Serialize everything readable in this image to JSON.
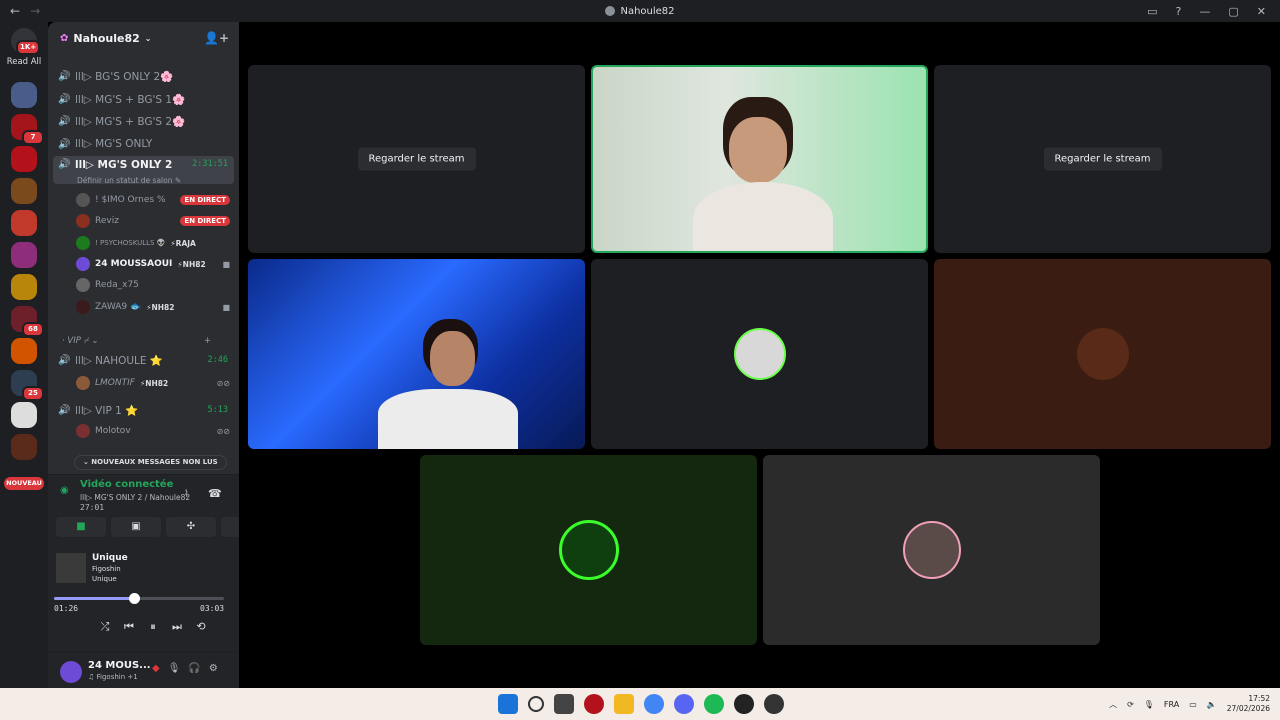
{
  "window": {
    "title": "Nahoule82",
    "back_icon": "←",
    "fwd_icon": "→"
  },
  "rail": {
    "read_all": "Read All",
    "top_badge": "1K+",
    "nouveau": "NOUVEAU",
    "servers": [
      {
        "color": "#4a5d8a",
        "badge": ""
      },
      {
        "color": "#a3141b",
        "badge": "7"
      },
      {
        "color": "#b3121b",
        "badge": ""
      },
      {
        "color": "#7a4a1c",
        "badge": ""
      },
      {
        "color": "#c0392b",
        "badge": ""
      },
      {
        "color": "#8e2d7a",
        "badge": ""
      },
      {
        "color": "#b8860b",
        "badge": ""
      },
      {
        "color": "#6d1f2a",
        "badge": "68"
      },
      {
        "color": "#d35400",
        "badge": ""
      },
      {
        "color": "#2c3e50",
        "badge": "25"
      },
      {
        "color": "#dddddd",
        "badge": ""
      },
      {
        "color": "#5a2a1a",
        "badge": ""
      }
    ]
  },
  "server": {
    "name": "Nahoule82"
  },
  "channels": [
    {
      "name": "lll▷ BG'S ONLY 2🌸"
    },
    {
      "name": "lll▷ MG'S + BG'S 1🌸"
    },
    {
      "name": "lll▷ MG'S + BG'S 2🌸"
    },
    {
      "name": "lll▷ MG'S ONLY"
    }
  ],
  "active_channel": {
    "name": "lll▷ MG'S ONLY 2",
    "time": "2:31:51",
    "status_hint": "Définir un statut de salon ✎"
  },
  "members": [
    {
      "name": "! $IMO Ornes %",
      "tag": "",
      "live": "EN DIRECT",
      "color": "#555"
    },
    {
      "name": "Reviz",
      "tag": "",
      "live": "EN DIRECT",
      "color": "#8b2f1f"
    },
    {
      "name": "! PSYCHOSKULLS 👽",
      "tag": "⚡RAJA",
      "live": "",
      "color": "#1d7a1d"
    },
    {
      "name": "24 MOUSSAOUI",
      "tag": "⚡NH82",
      "live": "",
      "color": "#6d4bd6"
    },
    {
      "name": "Reda_x75",
      "tag": "",
      "live": "",
      "color": "#666"
    },
    {
      "name": "ZAWA9 🐟",
      "tag": "⚡NH82",
      "live": "",
      "color": "#3a1a1a"
    }
  ],
  "category": {
    "name": "· VIP ⌿ ⌄",
    "plus": "+"
  },
  "vip_channels": [
    {
      "name": "lll▷ NAHOULE ⭐",
      "time": "2:46"
    },
    {
      "name": "lll▷ VIP 1 ⭐",
      "time": "5:13"
    }
  ],
  "vip_members": [
    {
      "name": "LMONTIF",
      "tag": "⚡NH82"
    },
    {
      "name": "Molotov",
      "tag": ""
    }
  ],
  "unread_pill": "⌄  NOUVEAUX MESSAGES NON LUS",
  "voice": {
    "status": "Vidéo connectée",
    "channel": "lll▷ MG'S ONLY 2 / Nahoule82",
    "elapsed": "27:01"
  },
  "song": {
    "title": "Unique",
    "artist": "Figoshin",
    "album": "Unique",
    "current": "01:26",
    "total": "03:03",
    "progress": 0.47
  },
  "user": {
    "name": "24 MOUS...",
    "sub": "♫ Figoshin +1"
  },
  "tiles": {
    "watch_label": "Regarder le stream"
  },
  "taskbar": {
    "lang": "FRA",
    "time": "17:52",
    "date": "27/02/2026"
  }
}
